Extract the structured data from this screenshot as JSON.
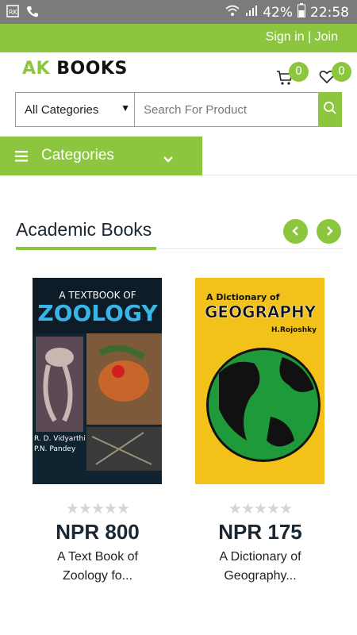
{
  "statusbar": {
    "battery": "42%",
    "time": "22:58"
  },
  "topbar": {
    "auth": "Sign in | Join"
  },
  "header": {
    "logo_ak": "AK",
    "logo_books": "BOOKS",
    "cart_count": "0",
    "wishlist_count": "0"
  },
  "search": {
    "category": "All Categories",
    "placeholder": "Search For Product"
  },
  "categories": {
    "label": "Categories"
  },
  "section": {
    "title": "Academic Books"
  },
  "products": [
    {
      "cover_line1": "A TEXTBOOK OF",
      "cover_line2": "ZOOLOGY",
      "cover_author1": "R. D. Vidyarthi",
      "cover_author2": "P.N. Pandey",
      "price": "NPR 800",
      "title_line1": "A Text Book of",
      "title_line2": "Zoology fo...",
      "rating": 0
    },
    {
      "cover_line1": "A Dictionary of",
      "cover_line2": "GEOGRAPHY",
      "cover_author1": "H.Rojoshky",
      "price": "NPR 175",
      "title_line1": "A Dictionary of",
      "title_line2": "Geography...",
      "rating": 0
    }
  ],
  "colors": {
    "accent": "#8cc63f",
    "statusbar": "#7b7b7b",
    "heading": "#1a2733"
  }
}
